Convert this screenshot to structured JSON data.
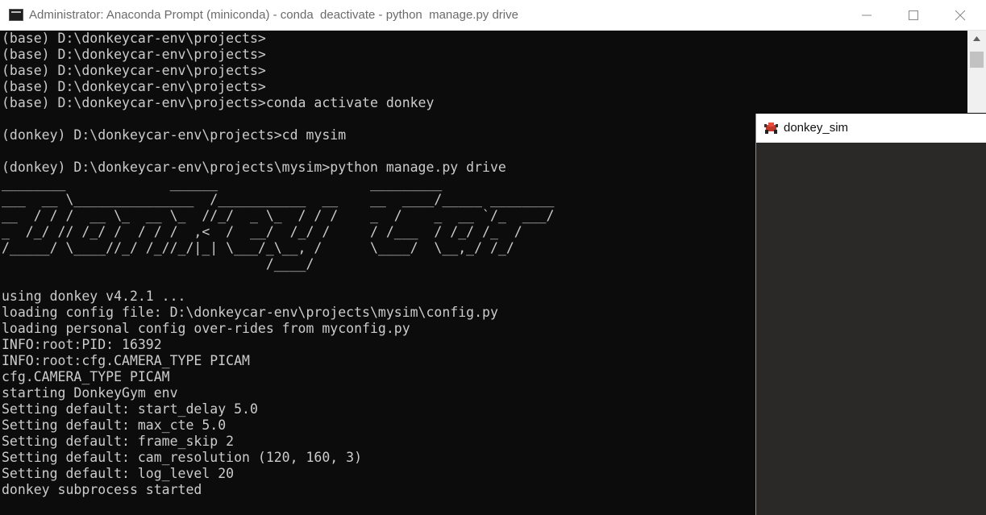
{
  "console_window": {
    "title": "Administrator: Anaconda Prompt (miniconda) - conda  deactivate - python  manage.py drive",
    "lines": [
      "(base) D:\\donkeycar-env\\projects>",
      "(base) D:\\donkeycar-env\\projects>",
      "(base) D:\\donkeycar-env\\projects>",
      "(base) D:\\donkeycar-env\\projects>",
      "(base) D:\\donkeycar-env\\projects>conda activate donkey",
      "",
      "(donkey) D:\\donkeycar-env\\projects>cd mysim",
      "",
      "(donkey) D:\\donkeycar-env\\projects\\mysim>python manage.py drive",
      "________             ______                   _________",
      "___  __ \\_______________  /___________  __    __  ____/_____ ________",
      "__  / / /  __ \\_  __ \\_  //_/  _ \\_  / / /    _  /    _  __ `/_  ___/",
      "_  /_/ // /_/ /  / / /  ,<  /  __/  /_/ /     / /___  / /_/ /_  /",
      "/_____/ \\____//_/ /_//_/|_| \\___/_\\__, /      \\____/  \\__,_/ /_/",
      "                                 /____/",
      "",
      "using donkey v4.2.1 ...",
      "loading config file: D:\\donkeycar-env\\projects\\mysim\\config.py",
      "loading personal config over-rides from myconfig.py",
      "INFO:root:PID: 16392",
      "INFO:root:cfg.CAMERA_TYPE PICAM",
      "cfg.CAMERA_TYPE PICAM",
      "starting DonkeyGym env",
      "Setting default: start_delay 5.0",
      "Setting default: max_cte 5.0",
      "Setting default: frame_skip 2",
      "Setting default: cam_resolution (120, 160, 3)",
      "Setting default: log_level 20",
      "donkey subprocess started"
    ]
  },
  "sim_window": {
    "title": "donkey_sim"
  },
  "icons": {
    "console": "terminal-icon",
    "minimize": "minimize-icon",
    "maximize": "maximize-icon",
    "close": "close-icon",
    "scroll_up": "scroll-up-arrow-icon",
    "sim": "donkey-sim-app-icon"
  },
  "colors": {
    "console_background": "#0c0c0c",
    "console_text": "#cccccc",
    "sim_background": "#2b2828"
  }
}
